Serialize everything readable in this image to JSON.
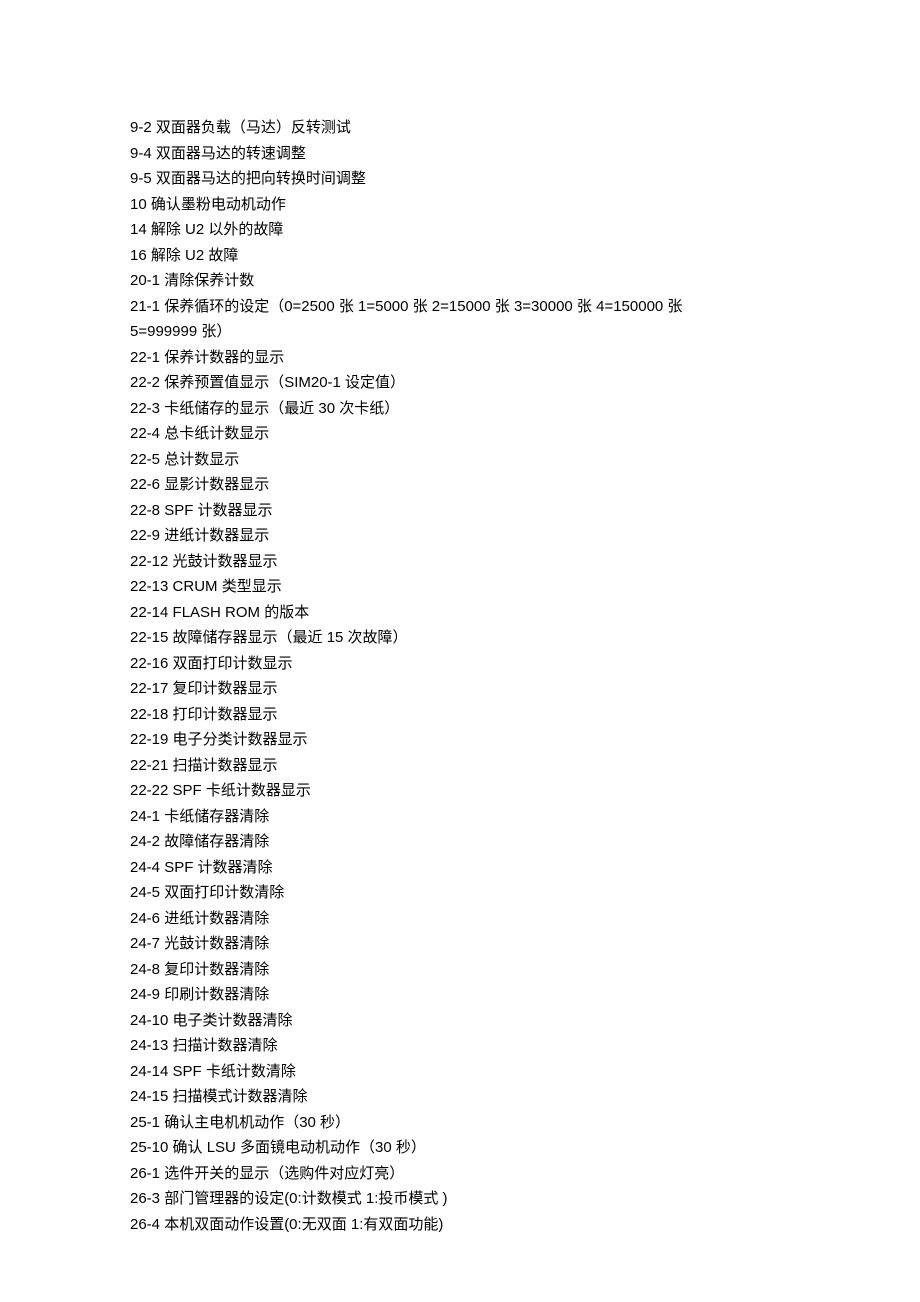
{
  "lines": [
    "9-2 双面器负载（马达）反转测试",
    "9-4 双面器马达的转速调整",
    "9-5 双面器马达的把向转换时间调整",
    "10 确认墨粉电动机动作",
    "14 解除 U2 以外的故障",
    "16 解除 U2 故障",
    "20-1 清除保养计数",
    "21-1 保养循环的设定（0=2500 张 1=5000 张 2=15000 张 3=30000 张 4=150000 张",
    "5=999999 张）",
    "22-1 保养计数器的显示",
    "22-2 保养预置值显示（SIM20-1 设定值）",
    "22-3 卡纸储存的显示（最近 30 次卡纸）",
    "22-4 总卡纸计数显示",
    "22-5 总计数显示",
    "22-6 显影计数器显示",
    "22-8 SPF 计数器显示",
    "22-9 进纸计数器显示",
    "22-12 光鼓计数器显示",
    "22-13 CRUM 类型显示",
    "22-14 FLASH ROM 的版本",
    "22-15 故障储存器显示（最近 15 次故障）",
    "22-16 双面打印计数显示",
    "22-17 复印计数器显示",
    "22-18 打印计数器显示",
    "22-19 电子分类计数器显示",
    "22-21 扫描计数器显示",
    "22-22 SPF 卡纸计数器显示",
    "24-1 卡纸储存器清除",
    "24-2 故障储存器清除",
    "24-4 SPF 计数器清除",
    "24-5 双面打印计数清除",
    "24-6 进纸计数器清除",
    "24-7 光鼓计数器清除",
    "24-8 复印计数器清除",
    "24-9 印刷计数器清除",
    "24-10 电子类计数器清除",
    "24-13 扫描计数器清除",
    "24-14 SPF 卡纸计数清除",
    "24-15 扫描模式计数器清除",
    "25-1 确认主电机机动作（30 秒）",
    "25-10 确认 LSU 多面镜电动机动作（30 秒）",
    "26-1 选件开关的显示（选购件对应灯亮）",
    "26-3 部门管理器的设定(0:计数模式 1:投币模式 )",
    "26-4 本机双面动作设置(0:无双面 1:有双面功能)"
  ]
}
